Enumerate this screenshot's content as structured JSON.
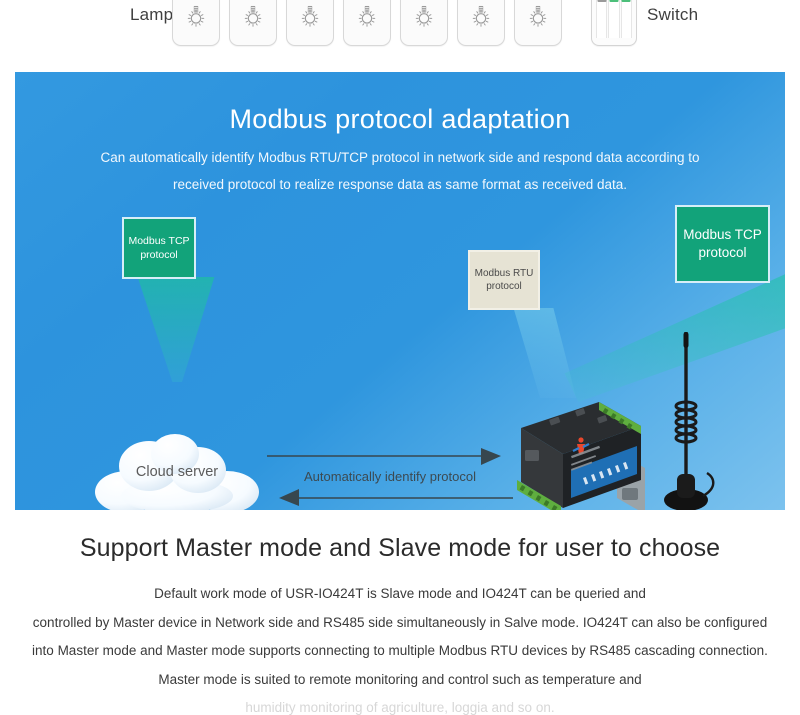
{
  "top_strip": {
    "lamp_label": "Lamp",
    "switch_label": "Switch",
    "lamp_count": 7,
    "switch_slots": 3
  },
  "blue_panel": {
    "title": "Modbus protocol adaptation",
    "subtitle_line1": "Can automatically identify Modbus RTU/TCP protocol in network side and respond data according to",
    "subtitle_line2": "received protocol to realize response data as same format as received data.",
    "box_tcp_left": "Modbus TCP protocol",
    "box_rtu": "Modbus RTU protocol",
    "box_tcp_right": "Modbus TCP protocol",
    "cloud_label": "Cloud server",
    "arrow_label": "Automatically identify protocol",
    "colors": {
      "panel_blue": "#2f96de",
      "box_green": "#12a37a",
      "box_beige": "#e6e3d4",
      "beam_teal": "#1ebea0",
      "device_blue": "#1f6fb5",
      "terminal_green": "#5fae3f"
    }
  },
  "bottom_section": {
    "title": "Support Master mode and Slave mode for user to choose",
    "lines": [
      "Default work mode of USR-IO424T is Slave mode and IO424T can be queried and",
      "controlled by Master device in Network side and RS485 side simultaneously in Salve mode. IO424T can also be configured",
      "into Master mode and Master mode supports connecting to multiple Modbus RTU devices by RS485 cascading connection.",
      "Master mode is suited to remote monitoring and control such as temperature and",
      "humidity monitoring of agriculture, loggia and so on."
    ]
  }
}
